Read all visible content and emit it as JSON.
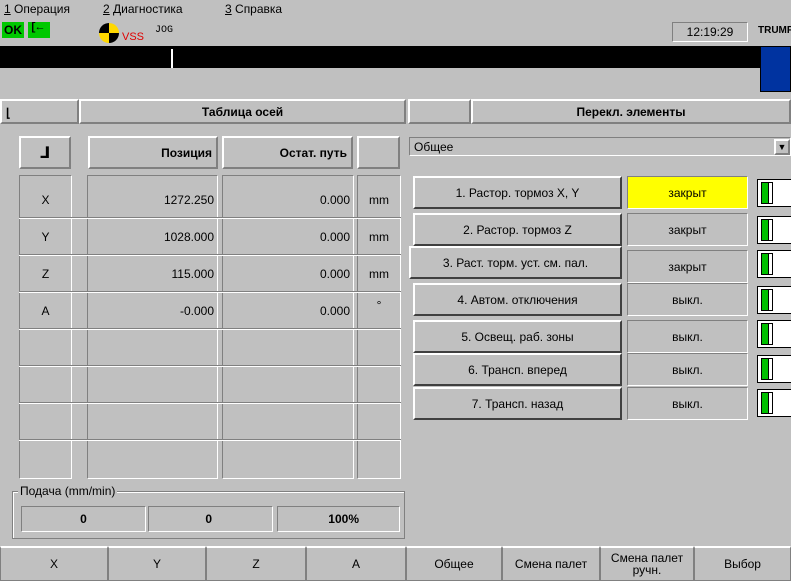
{
  "menu": [
    {
      "num": "1",
      "label": " Операция"
    },
    {
      "num": "2",
      "label": " Диагностика"
    },
    {
      "num": "3",
      "label": " Справка"
    }
  ],
  "status": {
    "ok": "OK",
    "vss": "VSS",
    "mode": "JOG",
    "time": "12:19:29",
    "brand": "TRUMPF"
  },
  "axis_panel": {
    "title": "Таблица осей",
    "col_position": "Позиция",
    "col_remaining": "Остат. путь",
    "rows": [
      {
        "axis": "X",
        "position": "1272.250",
        "remaining": "0.000",
        "unit": "mm"
      },
      {
        "axis": "Y",
        "position": "1028.000",
        "remaining": "0.000",
        "unit": "mm"
      },
      {
        "axis": "Z",
        "position": "115.000",
        "remaining": "0.000",
        "unit": "mm"
      },
      {
        "axis": "A",
        "position": "-0.000",
        "remaining": "0.000",
        "unit": "°"
      }
    ]
  },
  "feed": {
    "label": "Подача (mm/min)",
    "v1": "0",
    "v2": "0",
    "v3": "100%"
  },
  "switch_panel": {
    "title": "Перекл. элементы",
    "dropdown": "Общее",
    "rows": [
      {
        "label": "1. Растор. тормоз X, Y",
        "state": "закрыт",
        "highlight": true
      },
      {
        "label": "2. Растор. тормоз Z",
        "state": "закрыт",
        "highlight": false
      },
      {
        "label": "3. Раст. торм. уст. см. пал.",
        "state": "закрыт",
        "highlight": false
      },
      {
        "label": "4. Автом. отключения",
        "state": "выкл.",
        "highlight": false
      },
      {
        "label": "5. Освещ. раб. зоны",
        "state": "выкл.",
        "highlight": false
      },
      {
        "label": "6. Трансп. вперед",
        "state": "выкл.",
        "highlight": false
      },
      {
        "label": "7. Трансп. назад",
        "state": "выкл.",
        "highlight": false
      }
    ]
  },
  "softkeys": [
    "X",
    "Y",
    "Z",
    "A",
    "Общее",
    "Смена палет",
    "Смена палет ручн.",
    "Выбор"
  ]
}
